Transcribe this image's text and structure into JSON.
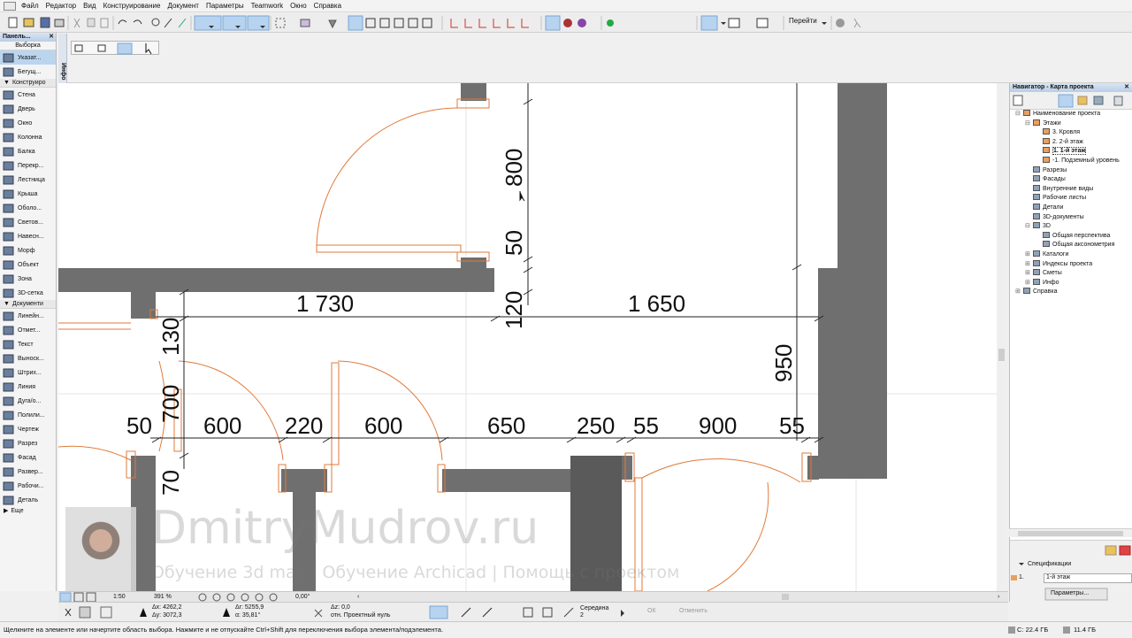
{
  "menu": {
    "items": [
      "Файл",
      "Редактор",
      "Вид",
      "Конструирование",
      "Документ",
      "Параметры",
      "Teamwork",
      "Окно",
      "Справка"
    ]
  },
  "toolbar": {
    "goto_label": "Перейти"
  },
  "info_panel": {
    "label": "Инфо"
  },
  "toolbox": {
    "title": "Панель...",
    "section_select": "Выборка",
    "select_tools": [
      {
        "label": "Указат...",
        "icon": "arrow-pointer-icon",
        "selected": true
      },
      {
        "label": "Бегущ...",
        "icon": "marquee-icon",
        "selected": false
      }
    ],
    "section_design": "Конструиро",
    "design_tools": [
      {
        "label": "Стена",
        "icon": "wall-icon"
      },
      {
        "label": "Дверь",
        "icon": "door-icon"
      },
      {
        "label": "Окно",
        "icon": "window-icon"
      },
      {
        "label": "Колонна",
        "icon": "column-icon"
      },
      {
        "label": "Балка",
        "icon": "beam-icon"
      },
      {
        "label": "Перекр...",
        "icon": "slab-icon"
      },
      {
        "label": "Лестница",
        "icon": "stair-icon"
      },
      {
        "label": "Крыша",
        "icon": "roof-icon"
      },
      {
        "label": "Оболо...",
        "icon": "shell-icon"
      },
      {
        "label": "Светов...",
        "icon": "skylight-icon"
      },
      {
        "label": "Навесн...",
        "icon": "curtain-wall-icon"
      },
      {
        "label": "Морф",
        "icon": "morph-icon"
      },
      {
        "label": "Объект",
        "icon": "object-icon"
      },
      {
        "label": "Зона",
        "icon": "zone-icon"
      },
      {
        "label": "3D-сетка",
        "icon": "mesh-icon"
      }
    ],
    "section_document": "Документи",
    "document_tools": [
      {
        "label": "Линейн...",
        "icon": "dimension-icon"
      },
      {
        "label": "Отмет...",
        "icon": "level-dimension-icon"
      },
      {
        "label": "Текст",
        "icon": "text-icon"
      },
      {
        "label": "Выноск...",
        "icon": "label-icon"
      },
      {
        "label": "Штрих...",
        "icon": "fill-icon"
      },
      {
        "label": "Линия",
        "icon": "line-icon"
      },
      {
        "label": "Дуга/о...",
        "icon": "arc-icon"
      },
      {
        "label": "Полили...",
        "icon": "polyline-icon"
      },
      {
        "label": "Чертеж",
        "icon": "drawing-icon"
      },
      {
        "label": "Разрез",
        "icon": "section-icon"
      },
      {
        "label": "Фасад",
        "icon": "elevation-icon"
      },
      {
        "label": "Развер...",
        "icon": "interior-elevation-icon"
      },
      {
        "label": "Рабочи...",
        "icon": "worksheet-icon"
      },
      {
        "label": "Деталь",
        "icon": "detail-icon"
      }
    ],
    "more_label": "Еще"
  },
  "navigator": {
    "title": "Навигатор - Карта проекта",
    "tree": [
      {
        "label": "Наименование проекта",
        "level": 0,
        "toggle": "⊟",
        "icon": "project-icon"
      },
      {
        "label": "Этажи",
        "level": 1,
        "toggle": "⊟",
        "icon": "stories-icon"
      },
      {
        "label": "3. Кровля",
        "level": 2,
        "toggle": "",
        "icon": "story-icon"
      },
      {
        "label": "2. 2-й этаж",
        "level": 2,
        "toggle": "",
        "icon": "story-icon"
      },
      {
        "label": "1. 1-й этаж",
        "level": 2,
        "toggle": "",
        "icon": "story-icon",
        "active": true
      },
      {
        "label": "-1. Подземный уровень",
        "level": 2,
        "toggle": "",
        "icon": "story-icon"
      },
      {
        "label": "Разрезы",
        "level": 1,
        "toggle": "",
        "icon": "sections-icon"
      },
      {
        "label": "Фасады",
        "level": 1,
        "toggle": "",
        "icon": "elevations-icon"
      },
      {
        "label": "Внутренние виды",
        "level": 1,
        "toggle": "",
        "icon": "interior-icon"
      },
      {
        "label": "Рабочие листы",
        "level": 1,
        "toggle": "",
        "icon": "worksheets-icon"
      },
      {
        "label": "Детали",
        "level": 1,
        "toggle": "",
        "icon": "details-icon"
      },
      {
        "label": "3D-документы",
        "level": 1,
        "toggle": "",
        "icon": "3d-docs-icon"
      },
      {
        "label": "3D",
        "level": 1,
        "toggle": "⊟",
        "icon": "3d-icon"
      },
      {
        "label": "Общая перспектива",
        "level": 2,
        "toggle": "",
        "icon": "perspective-icon"
      },
      {
        "label": "Общая аксонометрия",
        "level": 2,
        "toggle": "",
        "icon": "axonometry-icon"
      },
      {
        "label": "Каталоги",
        "level": 1,
        "toggle": "⊞",
        "icon": "catalogs-icon"
      },
      {
        "label": "Индексы проекта",
        "level": 1,
        "toggle": "⊞",
        "icon": "indexes-icon"
      },
      {
        "label": "Сметы",
        "level": 1,
        "toggle": "⊞",
        "icon": "estimates-icon"
      },
      {
        "label": "Инфо",
        "level": 1,
        "toggle": "⊞",
        "icon": "info-icon"
      },
      {
        "label": "Справка",
        "level": 0,
        "toggle": "⊞",
        "icon": "help-icon"
      }
    ],
    "spec_label": "Спецификации",
    "spec_value": "1-й этаж",
    "spec_prefix": "1.",
    "params_button": "Параметры..."
  },
  "drawing": {
    "dimensions": {
      "d800": "800",
      "d50_top": "50",
      "d120": "120",
      "d1730": "1 730",
      "d1650": "1 650",
      "d130": "130",
      "d950": "950",
      "d700": "700",
      "d70": "70",
      "row": [
        "50",
        "600",
        "220",
        "600",
        "650",
        "250",
        "55",
        "900",
        "55"
      ]
    },
    "watermark": "DmitryMudrov.ru",
    "watermark_sub": "Обучение 3d max | Обучение Archicad | Помощь с проектом",
    "colors": {
      "wall": "#6f6f6f",
      "wall_dark": "#5a5a5a",
      "door": "#e07a3a",
      "dim": "#111111"
    }
  },
  "bottom_bar": {
    "scale": "1:50",
    "zoom": "391 %",
    "angle": "0,00°"
  },
  "coords": {
    "dx": "Δx: 4262,2",
    "dy": "Δy: 3072,3",
    "dr": "Δr: 5255,9",
    "da": "α: 35,81°",
    "dz": "Δz: 0,0",
    "ref": "отн. Проектный нуль",
    "snap_label": "Середина",
    "snap_value": "2",
    "ok": "ОК",
    "cancel": "Отменить"
  },
  "status": {
    "message": "Щелкните на элементе или начертите область выбора. Нажмите и не отпускайте Ctrl+Shift для переключения выбора элемента/подэлемента.",
    "disk_c": "C: 22.4 ГБ",
    "disk_other": "11.4 ГБ"
  }
}
